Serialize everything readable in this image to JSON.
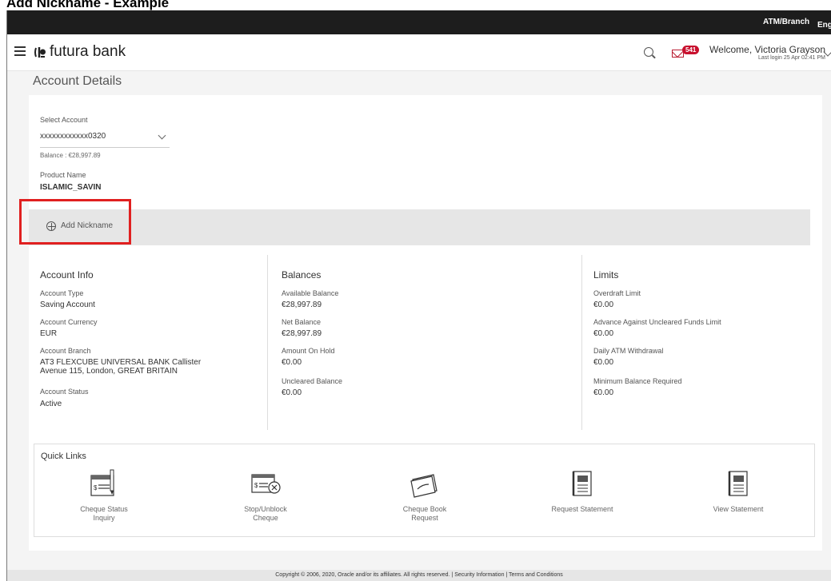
{
  "doc_caption": "Add Nickname - Example",
  "topbar": {
    "atm_branch": "ATM/Branch",
    "language": "English"
  },
  "header": {
    "logo_text": "futura bank",
    "mail_count": "541",
    "welcome": "Welcome, Victoria Grayson",
    "last_login": "Last login 25 Apr 02:41 PM"
  },
  "page_title": "Account Details",
  "account": {
    "select_label": "Select Account",
    "select_value": "xxxxxxxxxxxx0320",
    "balance": "Balance : €28,997.89",
    "product_label": "Product Name",
    "product_value": "ISLAMIC_SAVIN",
    "add_nickname": "Add Nickname"
  },
  "account_info": {
    "title": "Account Info",
    "type_label": "Account Type",
    "type_value": "Saving Account",
    "currency_label": "Account Currency",
    "currency_value": "EUR",
    "branch_label": "Account Branch",
    "branch_value_1": "AT3 FLEXCUBE UNIVERSAL BANK Callister",
    "branch_value_2": "Avenue 115, London, GREAT BRITAIN",
    "status_label": "Account Status",
    "status_value": "Active"
  },
  "balances": {
    "title": "Balances",
    "available_label": "Available Balance",
    "available_value": "€28,997.89",
    "net_label": "Net Balance",
    "net_value": "€28,997.89",
    "hold_label": "Amount On Hold",
    "hold_value": "€0.00",
    "uncleared_label": "Uncleared Balance",
    "uncleared_value": "€0.00"
  },
  "limits": {
    "title": "Limits",
    "overdraft_label": "Overdraft Limit",
    "overdraft_value": "€0.00",
    "advance_label": "Advance Against Uncleared Funds Limit",
    "advance_value": "€0.00",
    "atm_label": "Daily ATM Withdrawal",
    "atm_value": "€0.00",
    "min_label": "Minimum Balance Required",
    "min_value": "€0.00"
  },
  "quick_links": {
    "title": "Quick Links",
    "cheque_status_1": "Cheque Status",
    "cheque_status_2": "Inquiry",
    "stop_unblock_1": "Stop/Unblock",
    "stop_unblock_2": "Cheque",
    "cheque_book_1": "Cheque Book",
    "cheque_book_2": "Request",
    "request_statement": "Request Statement",
    "view_statement": "View Statement"
  },
  "footer": "Copyright © 2006, 2020, Oracle and/or its affiliates. All rights reserved. | Security Information | Terms and Conditions",
  "colors": {
    "topbar": "#1d1d1d",
    "badge": "#c8102e",
    "highlight": "#e02020",
    "band": "#e6e6e6"
  }
}
